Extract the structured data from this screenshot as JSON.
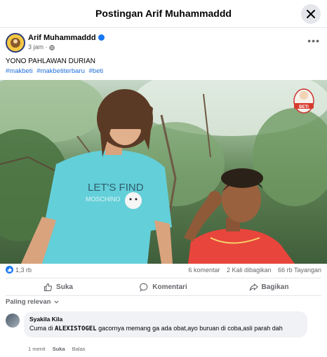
{
  "header": {
    "title": "Postingan Arif Muhammaddd"
  },
  "author": {
    "name": "Arif Muhammaddd",
    "time": "3 jam",
    "privacy_sep": "·"
  },
  "post": {
    "text": "YONO PAHLAWAN DURIAN",
    "hashtags": [
      "#makbeti",
      "#makbetiterbaru",
      "#beti"
    ]
  },
  "media": {
    "sticker_text": "BETI",
    "shirt_text_1": "LET'S FIND",
    "shirt_text_2": "MOSCHINO"
  },
  "stats": {
    "reactions": "1,3 rb",
    "comments": "6 komentar",
    "shares": "2 Kali dibagikan",
    "views": "66 rb Tayangan"
  },
  "actions": {
    "like": "Suka",
    "comment": "Komentari",
    "share": "Bagikan"
  },
  "sort": "Paling relevan",
  "comment": {
    "name": "Syakila Kila",
    "text_before": "Cuma di ",
    "text_bold": "ALEXISTOGEL",
    "text_after": " gacornya memang ga ada obat,ayo buruan di coba,asli parah dah",
    "time": "1 menit",
    "like": "Suka",
    "reply": "Balas"
  },
  "colors": {
    "accent": "#1877f2",
    "link": "#216fdb",
    "muted": "#65676b"
  }
}
